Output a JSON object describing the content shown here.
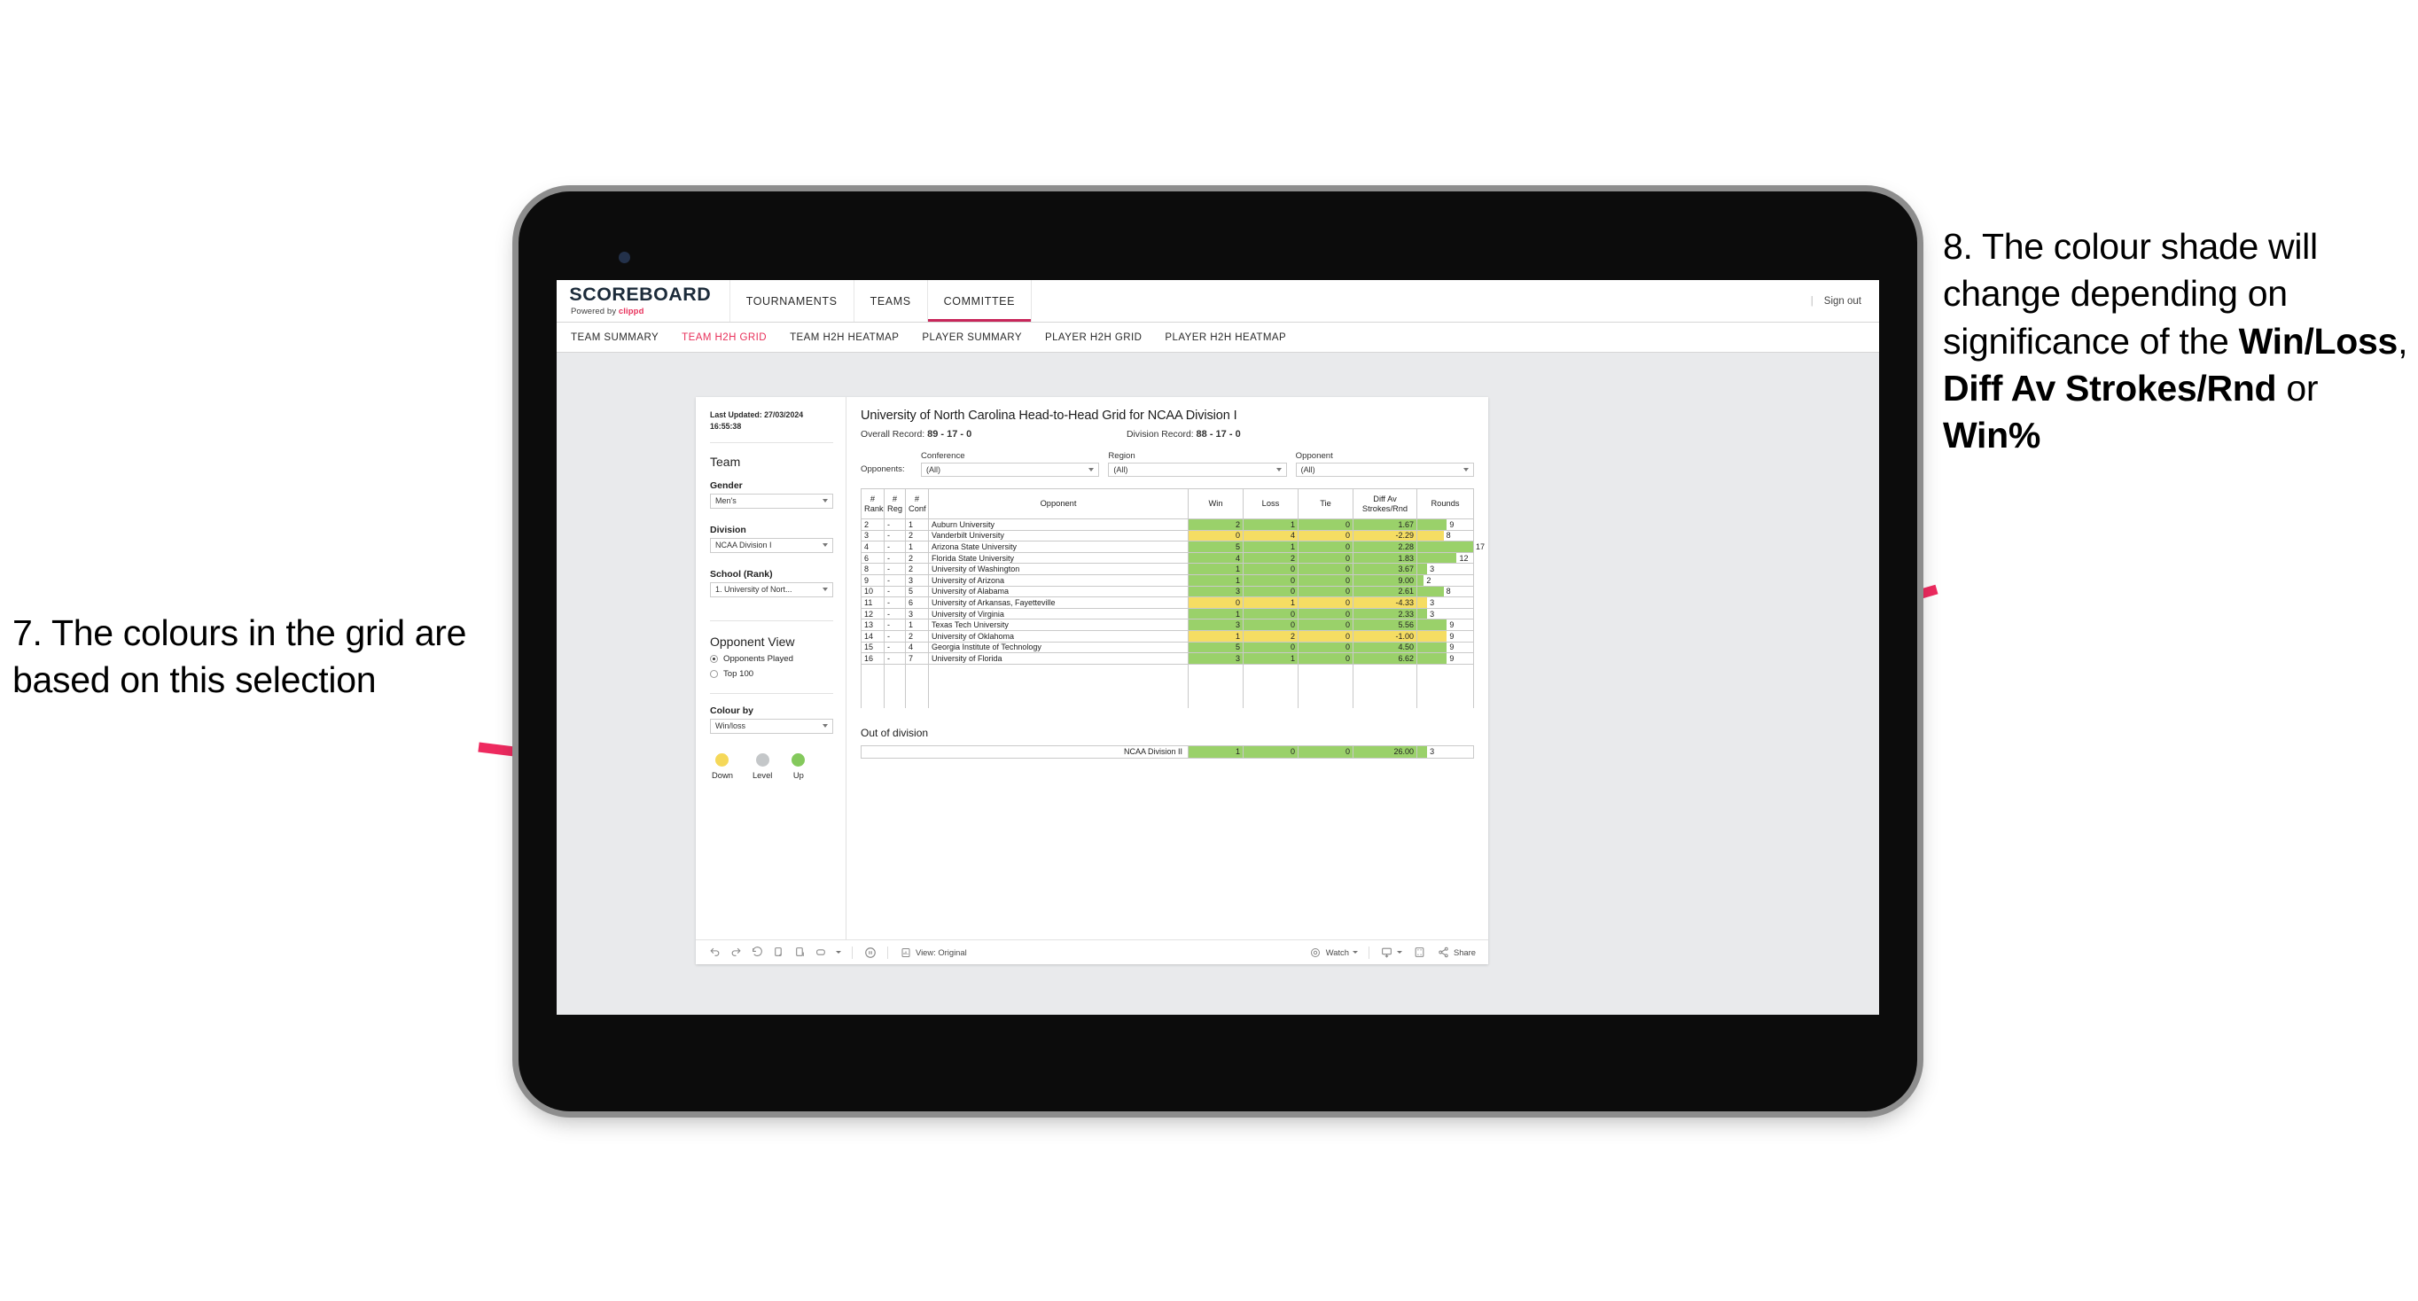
{
  "annotations": {
    "left": "7. The colours in the grid are based on this selection",
    "right_pre": "8. The colour shade will change depending on significance of the ",
    "right_b1": "Win/Loss",
    "right_mid1": ", ",
    "right_b2": "Diff Av Strokes/Rnd",
    "right_mid2": " or ",
    "right_b3": "Win%",
    "arrow_color": "#ee2a5f"
  },
  "app": {
    "brand_word": "SCOREBOARD",
    "brand_powered": "Powered by ",
    "brand_clippd": "clippd",
    "signout": "Sign out",
    "sep": "|",
    "topnav": [
      {
        "label": "TOURNAMENTS",
        "active": false
      },
      {
        "label": "TEAMS",
        "active": false
      },
      {
        "label": "COMMITTEE",
        "active": true
      }
    ],
    "subnav": [
      {
        "label": "TEAM SUMMARY",
        "active": false
      },
      {
        "label": "TEAM H2H GRID",
        "active": true
      },
      {
        "label": "TEAM H2H HEATMAP",
        "active": false
      },
      {
        "label": "PLAYER SUMMARY",
        "active": false
      },
      {
        "label": "PLAYER H2H GRID",
        "active": false
      },
      {
        "label": "PLAYER H2H HEATMAP",
        "active": false
      }
    ]
  },
  "sidebar": {
    "last_updated_label": "Last Updated: ",
    "last_updated_value": "27/03/2024 16:55:38",
    "team_heading": "Team",
    "gender_label": "Gender",
    "gender_value": "Men's",
    "division_label": "Division",
    "division_value": "NCAA Division I",
    "school_label": "School (Rank)",
    "school_value": "1. University of Nort...",
    "opponent_view_heading": "Opponent View",
    "radio_played": "Opponents Played",
    "radio_top100": "Top 100",
    "colour_by_label": "Colour by",
    "colour_by_value": "Win/loss",
    "legend": [
      {
        "label": "Down",
        "color": "#f5d859"
      },
      {
        "label": "Level",
        "color": "#c4c7c9"
      },
      {
        "label": "Up",
        "color": "#84c95c"
      }
    ]
  },
  "viz": {
    "title": "University of North Carolina Head-to-Head Grid for NCAA Division I",
    "overall_record_label": "Overall Record: ",
    "overall_record_value": "89 - 17 - 0",
    "division_record_label": "Division Record: ",
    "division_record_value": "88 - 17 - 0",
    "opponents_label": "Opponents:",
    "filters": [
      {
        "label": "Conference",
        "value": "(All)"
      },
      {
        "label": "Region",
        "value": "(All)"
      },
      {
        "label": "Opponent",
        "value": "(All)"
      }
    ],
    "out_of_division_title": "Out of division"
  },
  "chart_data": {
    "type": "table",
    "title": "University of North Carolina Head-to-Head Grid for NCAA Division I",
    "colour_by": "Win/loss",
    "colors": {
      "up": "#9ad16a",
      "down": "#f5dd63",
      "level": "#c4c7c9",
      "neutral": "#ffffff"
    },
    "columns": [
      "# Rank",
      "# Reg",
      "# Conf",
      "Opponent",
      "Win",
      "Loss",
      "Tie",
      "Diff Av Strokes/Rnd",
      "Rounds"
    ],
    "rounds_max": 17,
    "rows": [
      {
        "rank": "2",
        "reg": "-",
        "conf": "1",
        "opponent": "Auburn University",
        "win": "2",
        "loss": "1",
        "tie": "0",
        "diff": "1.67",
        "rounds": "9",
        "rounds_n": 9,
        "state": "up"
      },
      {
        "rank": "3",
        "reg": "-",
        "conf": "2",
        "opponent": "Vanderbilt University",
        "win": "0",
        "loss": "4",
        "tie": "0",
        "diff": "-2.29",
        "rounds": "8",
        "rounds_n": 8,
        "state": "down"
      },
      {
        "rank": "4",
        "reg": "-",
        "conf": "1",
        "opponent": "Arizona State University",
        "win": "5",
        "loss": "1",
        "tie": "0",
        "diff": "2.28",
        "rounds": "17",
        "rounds_n": 17,
        "state": "up"
      },
      {
        "rank": "6",
        "reg": "-",
        "conf": "2",
        "opponent": "Florida State University",
        "win": "4",
        "loss": "2",
        "tie": "0",
        "diff": "1.83",
        "rounds": "12",
        "rounds_n": 12,
        "state": "up"
      },
      {
        "rank": "8",
        "reg": "-",
        "conf": "2",
        "opponent": "University of Washington",
        "win": "1",
        "loss": "0",
        "tie": "0",
        "diff": "3.67",
        "rounds": "3",
        "rounds_n": 3,
        "state": "up"
      },
      {
        "rank": "9",
        "reg": "-",
        "conf": "3",
        "opponent": "University of Arizona",
        "win": "1",
        "loss": "0",
        "tie": "0",
        "diff": "9.00",
        "rounds": "2",
        "rounds_n": 2,
        "state": "up"
      },
      {
        "rank": "10",
        "reg": "-",
        "conf": "5",
        "opponent": "University of Alabama",
        "win": "3",
        "loss": "0",
        "tie": "0",
        "diff": "2.61",
        "rounds": "8",
        "rounds_n": 8,
        "state": "up"
      },
      {
        "rank": "11",
        "reg": "-",
        "conf": "6",
        "opponent": "University of Arkansas, Fayetteville",
        "win": "0",
        "loss": "1",
        "tie": "0",
        "diff": "-4.33",
        "rounds": "3",
        "rounds_n": 3,
        "state": "down"
      },
      {
        "rank": "12",
        "reg": "-",
        "conf": "3",
        "opponent": "University of Virginia",
        "win": "1",
        "loss": "0",
        "tie": "0",
        "diff": "2.33",
        "rounds": "3",
        "rounds_n": 3,
        "state": "up"
      },
      {
        "rank": "13",
        "reg": "-",
        "conf": "1",
        "opponent": "Texas Tech University",
        "win": "3",
        "loss": "0",
        "tie": "0",
        "diff": "5.56",
        "rounds": "9",
        "rounds_n": 9,
        "state": "up"
      },
      {
        "rank": "14",
        "reg": "-",
        "conf": "2",
        "opponent": "University of Oklahoma",
        "win": "1",
        "loss": "2",
        "tie": "0",
        "diff": "-1.00",
        "rounds": "9",
        "rounds_n": 9,
        "state": "down"
      },
      {
        "rank": "15",
        "reg": "-",
        "conf": "4",
        "opponent": "Georgia Institute of Technology",
        "win": "5",
        "loss": "0",
        "tie": "0",
        "diff": "4.50",
        "rounds": "9",
        "rounds_n": 9,
        "state": "up"
      },
      {
        "rank": "16",
        "reg": "-",
        "conf": "7",
        "opponent": "University of Florida",
        "win": "3",
        "loss": "1",
        "tie": "0",
        "diff": "6.62",
        "rounds": "9",
        "rounds_n": 9,
        "state": "up"
      }
    ],
    "out_of_division": [
      {
        "label": "NCAA Division II",
        "win": "1",
        "loss": "0",
        "tie": "0",
        "diff": "26.00",
        "rounds": "3",
        "rounds_n": 3,
        "state": "up"
      }
    ]
  },
  "toolbar": {
    "view_label": "View: Original",
    "watch_label": "Watch",
    "share_label": "Share"
  }
}
